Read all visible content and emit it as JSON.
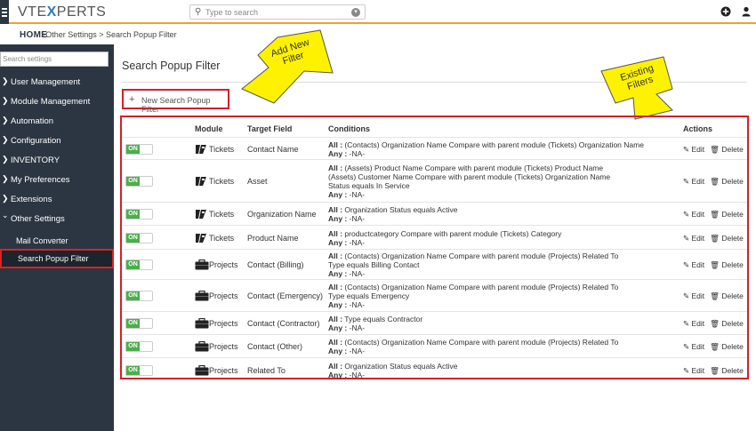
{
  "app": {
    "logo_prefix": "VTE",
    "logo_x": "X",
    "logo_suffix": "PERTS",
    "search_placeholder": "Type to search"
  },
  "breadcrumb": {
    "home": "HOME",
    "path": ">Other Settings >  Search Popup Filter"
  },
  "sidebar": {
    "search_placeholder": "Search settings",
    "items": [
      {
        "label": "User Management",
        "arrow": "❯"
      },
      {
        "label": "Module Management",
        "arrow": "❯"
      },
      {
        "label": "Automation",
        "arrow": "❯"
      },
      {
        "label": "Configuration",
        "arrow": "❯"
      },
      {
        "label": "INVENTORY",
        "arrow": "❯"
      },
      {
        "label": "My Preferences",
        "arrow": "❯"
      },
      {
        "label": "Extensions",
        "arrow": "❯"
      },
      {
        "label": "Other Settings",
        "arrow": "⌄"
      }
    ],
    "subitems": [
      {
        "label": "Mail Converter"
      },
      {
        "label": "Search Popup Filter",
        "active": true
      }
    ]
  },
  "page": {
    "title": "Search Popup Filter",
    "new_button": "New Search Popup Filter"
  },
  "callouts": {
    "add": "Add New Filter",
    "existing": "Existing Filters"
  },
  "table": {
    "headers": {
      "module": "Module",
      "target": "Target Field",
      "conditions": "Conditions",
      "actions": "Actions"
    },
    "toggle_label": "ON",
    "edit_label": "Edit",
    "delete_label": "Delete",
    "rows": [
      {
        "module": "Tickets",
        "target": "Contact Name",
        "lines": [
          [
            "All :",
            " (Contacts) Organization Name Compare with parent module (Tickets) Organization Name"
          ],
          [
            "Any :",
            "  -NA-"
          ]
        ]
      },
      {
        "module": "Tickets",
        "target": "Asset",
        "lines": [
          [
            "All :",
            " (Assets) Product Name Compare with parent module (Tickets) Product Name"
          ],
          [
            "",
            "(Assets) Customer Name Compare with parent module (Tickets) Organization Name"
          ],
          [
            "",
            "Status equals In Service"
          ],
          [
            "Any :",
            "  -NA-"
          ]
        ]
      },
      {
        "module": "Tickets",
        "target": "Organization Name",
        "lines": [
          [
            "All :",
            " Organization Status equals Active"
          ],
          [
            "Any :",
            "  -NA-"
          ]
        ]
      },
      {
        "module": "Tickets",
        "target": "Product Name",
        "lines": [
          [
            "All :",
            " productcategory Compare with parent module (Tickets) Category"
          ],
          [
            "Any :",
            "  -NA-"
          ]
        ]
      },
      {
        "module": "Projects",
        "target": "Contact (Billing)",
        "lines": [
          [
            "All :",
            " (Contacts) Organization Name Compare with parent module (Projects) Related To"
          ],
          [
            "",
            "Type equals Billing Contact"
          ],
          [
            "Any :",
            "  -NA-"
          ]
        ]
      },
      {
        "module": "Projects",
        "target": "Contact (Emergency)",
        "lines": [
          [
            "All :",
            " (Contacts) Organization Name Compare with parent module (Projects) Related To"
          ],
          [
            "",
            "Type equals Emergency"
          ],
          [
            "Any :",
            "  -NA-"
          ]
        ]
      },
      {
        "module": "Projects",
        "target": "Contact (Contractor)",
        "lines": [
          [
            "All :",
            " Type equals Contractor"
          ],
          [
            "Any :",
            "  -NA-"
          ]
        ]
      },
      {
        "module": "Projects",
        "target": "Contact (Other)",
        "lines": [
          [
            "All :",
            " (Contacts) Organization Name Compare with parent module (Projects) Related To"
          ],
          [
            "Any :",
            "  -NA-"
          ]
        ]
      },
      {
        "module": "Projects",
        "target": "Related To",
        "lines": [
          [
            "All :",
            " Organization Status equals Active"
          ],
          [
            "Any :",
            "  -NA-"
          ]
        ]
      }
    ]
  }
}
